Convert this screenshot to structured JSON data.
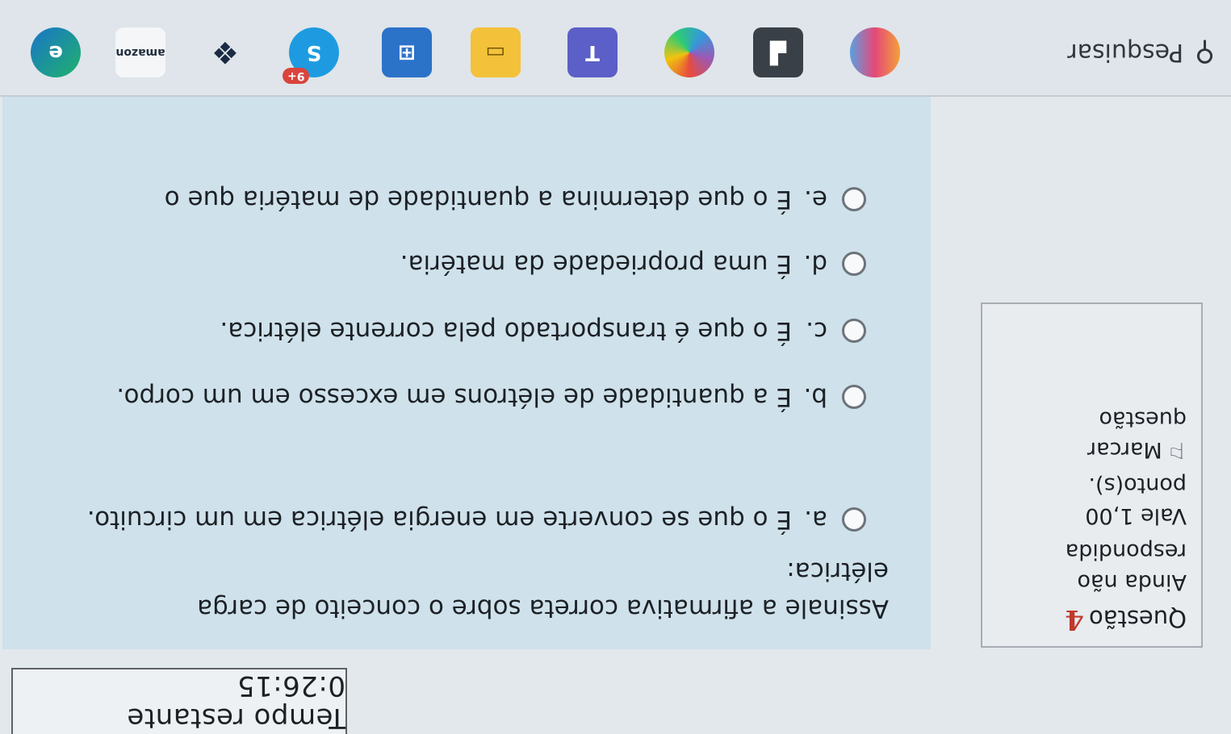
{
  "timer": {
    "text": "Tempo restante 0:26:15"
  },
  "info": {
    "question_label": "Questão",
    "question_number": "4",
    "status": "Ainda não respondida",
    "points": "Vale 1,00 ponto(s).",
    "flag_label": "Marcar questão"
  },
  "question": {
    "text": "Assinale a afirmativa correta sobre o conceito de carga elétrica:",
    "options": [
      {
        "label": "a.",
        "text": "É o que se converte em energia elétrica em um circuito."
      },
      {
        "label": "b.",
        "text": "É a quantidade de elétrons em excesso em um corpo."
      },
      {
        "label": "c.",
        "text": "É o que é transportado pela corrente elétrica."
      },
      {
        "label": "d.",
        "text": "É uma propriedade da matéria."
      },
      {
        "label": "e.",
        "text": "É o que determina a quantidade de matéria que o"
      }
    ]
  },
  "taskbar": {
    "search_label": "Pesquisar",
    "badge": "9+",
    "icons": [
      "edge-icon",
      "amazon-icon",
      "dropbox-icon",
      "skype-icon",
      "store-icon",
      "file-explorer-icon",
      "teams-icon",
      "copilot-icon",
      "snip-icon",
      "paint-icon"
    ],
    "accent": "#2f86c8"
  }
}
